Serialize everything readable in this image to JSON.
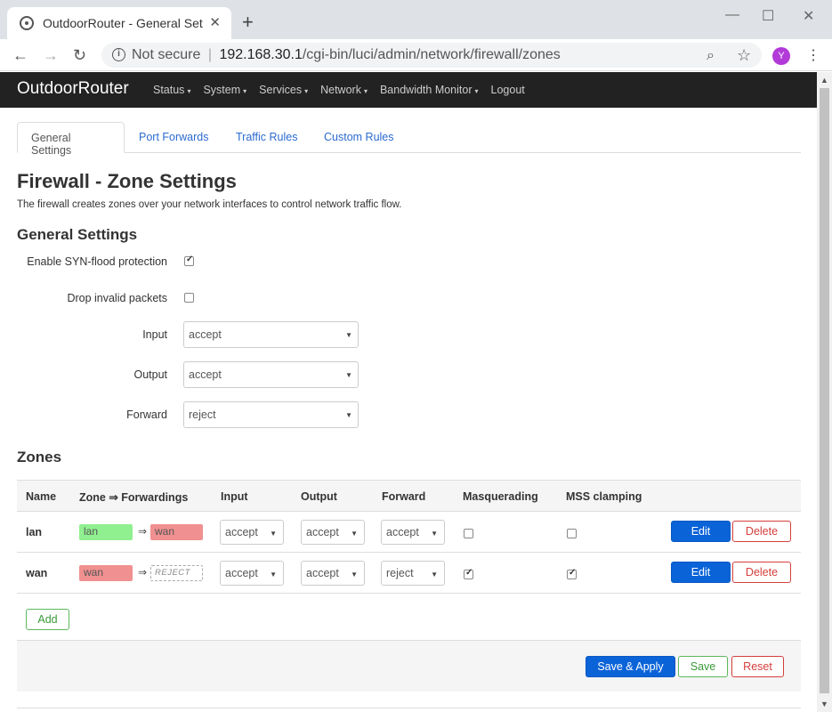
{
  "browser": {
    "tab_title": "OutdoorRouter - General Setti",
    "tab_close": "✕",
    "new_tab": "+",
    "minimize": "—",
    "maximize": "☐",
    "close": "✕",
    "back": "←",
    "forward": "→",
    "reload": "↻",
    "info": "i",
    "not_secure": "Not secure",
    "separator": "|",
    "url_host": "192.168.30.1",
    "url_path": "/cgi-bin/luci/admin/network/firewall/zones",
    "zoom_icon": "⌕",
    "star": "☆",
    "avatar_letter": "Y",
    "menu": "⋮"
  },
  "navbar": {
    "brand": "OutdoorRouter",
    "items": [
      "Status",
      "System",
      "Services",
      "Network",
      "Bandwidth Monitor",
      "Logout"
    ],
    "caret": "▾"
  },
  "tabs": [
    {
      "label": "General Settings",
      "active": true
    },
    {
      "label": "Port Forwards",
      "active": false
    },
    {
      "label": "Traffic Rules",
      "active": false
    },
    {
      "label": "Custom Rules",
      "active": false
    }
  ],
  "page": {
    "title": "Firewall - Zone Settings",
    "description": "The firewall creates zones over your network interfaces to control network traffic flow.",
    "general_heading": "General Settings",
    "zones_heading": "Zones"
  },
  "general": {
    "syn_label": "Enable SYN-flood protection",
    "syn_checked": true,
    "drop_label": "Drop invalid packets",
    "drop_checked": false,
    "input_label": "Input",
    "input_value": "accept",
    "output_label": "Output",
    "output_value": "accept",
    "forward_label": "Forward",
    "forward_value": "reject",
    "arrow": "▼"
  },
  "zones": {
    "headers": [
      "Name",
      "Zone ⇒ Forwardings",
      "Input",
      "Output",
      "Forward",
      "Masquerading",
      "MSS clamping"
    ],
    "fwd_arrow": "⇒",
    "rows": [
      {
        "name": "lan",
        "zone": "lan",
        "zone_color": "green",
        "fwd": "wan",
        "fwd_type": "zone",
        "input": "accept",
        "output": "accept",
        "forward": "accept",
        "masq": false,
        "mss": false,
        "edit": "Edit",
        "delete": "Delete"
      },
      {
        "name": "wan",
        "zone": "wan",
        "zone_color": "red",
        "fwd": "REJECT",
        "fwd_type": "reject",
        "input": "accept",
        "output": "accept",
        "forward": "reject",
        "masq": true,
        "mss": true,
        "edit": "Edit",
        "delete": "Delete"
      }
    ],
    "add_label": "Add"
  },
  "footer": {
    "save_apply": "Save & Apply",
    "save": "Save",
    "reset": "Reset"
  },
  "scrollbar": {
    "up": "▲",
    "down": "▼"
  }
}
